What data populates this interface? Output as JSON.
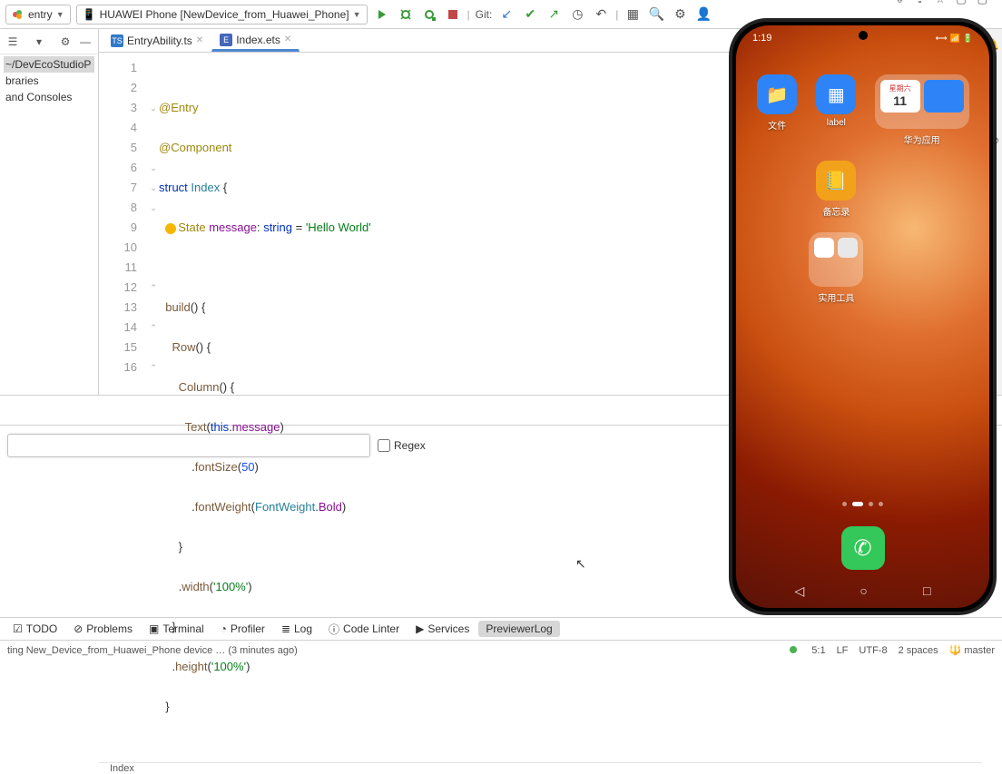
{
  "toolbar": {
    "module": "entry",
    "device": "HUAWEI Phone [NewDevice_from_Huawei_Phone]",
    "git_label": "Git:"
  },
  "left_panel": {
    "path_hint": "~/DevEcoStudioP",
    "item1": "braries",
    "item2": "and Consoles"
  },
  "tabs": [
    {
      "name": "EntryAbility.ts",
      "active": false
    },
    {
      "name": "Index.ets",
      "active": true
    }
  ],
  "code_lines": [
    "@Entry",
    "@Component",
    "struct Index {",
    "  @State message: string = 'Hello World'",
    "",
    "  build() {",
    "    Row() {",
    "      Column() {",
    "        Text(this.message)",
    "          .fontSize(50)",
    "          .fontWeight(FontWeight.Bold)",
    "      }",
    "      .width('100%')",
    "    }",
    "    .height('100%')",
    "  }"
  ],
  "code": {
    "l1a": "@Entry",
    "l2a": "@Component",
    "l3a": "struct ",
    "l3b": "Index ",
    "l3c": "{",
    "l4a": "State ",
    "l4b": "message",
    "l4c": ": ",
    "l4d": "string",
    "l4e": " = ",
    "l4f": "'Hello World'",
    "l6a": "build",
    "l6b": "() ",
    "l6c": "{",
    "l7a": "Row",
    "l7b": "() ",
    "l7c": "{",
    "l8a": "Column",
    "l8b": "() ",
    "l8c": "{",
    "l9a": "Text",
    "l9b": "(",
    "l9c": "this",
    "l9d": ".",
    "l9e": "message",
    "l9f": ")",
    "l10a": ".",
    "l10b": "fontSize",
    "l10c": "(",
    "l10d": "50",
    "l10e": ")",
    "l11a": ".",
    "l11b": "fontWeight",
    "l11c": "(",
    "l11d": "FontWeight",
    "l11e": ".",
    "l11f": "Bold",
    "l11g": ")",
    "l12a": "}",
    "l13a": ".",
    "l13b": "width",
    "l13c": "(",
    "l13d": "'100%'",
    "l13e": ")",
    "l14a": "}",
    "l15a": ".",
    "l15b": "height",
    "l15c": "(",
    "l15d": "'100%'",
    "l15e": ")",
    "l16a": "}"
  },
  "breadcrumb": "Index",
  "right_tabs": {
    "notifications": "Notifications",
    "previewer": "Previewer"
  },
  "find": {
    "regex_label": "Regex"
  },
  "bottom_tabs": {
    "todo": "TODO",
    "problems": "Problems",
    "terminal": "Terminal",
    "profiler": "Profiler",
    "log": "Log",
    "codelinter": "Code Linter",
    "services": "Services",
    "previewerlog": "PreviewerLog"
  },
  "status": {
    "msg": "ting New_Device_from_Huawei_Phone device … (3 minutes ago)",
    "pos": "5:1",
    "le": "LF",
    "enc": "UTF-8",
    "indent": "2 spaces",
    "branch": "master"
  },
  "phone": {
    "time": "1:19",
    "icons": {
      "files": "文件",
      "label": "label",
      "notes": "备忘录",
      "huawei": "华为应用",
      "tools": "实用工具",
      "cal_day": "11",
      "cal_wk": "星期六"
    },
    "nav": {
      "back": "◁",
      "home": "○",
      "recent": "□"
    }
  }
}
